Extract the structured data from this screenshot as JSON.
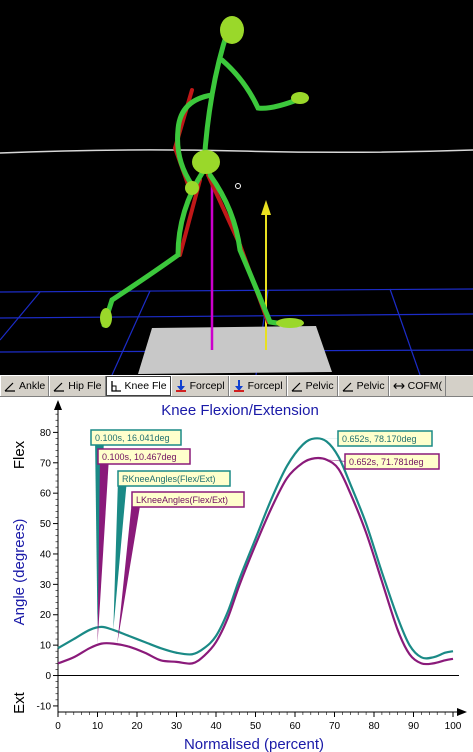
{
  "tabs": [
    {
      "label": "Ankle",
      "icon": "angle-icon",
      "active": false
    },
    {
      "label": "Hip Fle",
      "icon": "angle-icon",
      "active": false
    },
    {
      "label": "Knee Fle",
      "icon": "knee-angle-icon",
      "active": true
    },
    {
      "label": "Forcepl",
      "icon": "force-arrow-icon",
      "active": false
    },
    {
      "label": "Forcepl",
      "icon": "force-arrow-icon",
      "active": false
    },
    {
      "label": "Pelvic",
      "icon": "angle-icon",
      "active": false
    },
    {
      "label": "Pelvic",
      "icon": "angle-icon",
      "active": false
    },
    {
      "label": "COFM(",
      "icon": "double-arrow-icon",
      "active": false
    }
  ],
  "chart": {
    "flex_label": "Flex",
    "ext_label": "Ext"
  },
  "colors": {
    "right_series": "#1a8a86",
    "left_series": "#8a1a7a",
    "axis_text": "#1a1aa8",
    "box_fill": "#ffffcc",
    "force_line": "#cc00cc"
  },
  "chart_data": {
    "type": "line",
    "title": "Knee Flexion/Extension",
    "xlabel": "Normalised (percent)",
    "ylabel": "Angle (degrees)",
    "xlim": [
      0,
      100
    ],
    "ylim": [
      -12,
      90
    ],
    "xticks": [
      0,
      10,
      20,
      30,
      40,
      50,
      60,
      70,
      80,
      90,
      100
    ],
    "yticks": [
      -10,
      0,
      10,
      20,
      30,
      40,
      50,
      60,
      70,
      80
    ],
    "series": [
      {
        "name": "RKneeAngles(Flex/Ext)",
        "color": "#1a8a86",
        "x": [
          0,
          4,
          8,
          11,
          14,
          18,
          22,
          26,
          30,
          34,
          37,
          40,
          43,
          46,
          50,
          54,
          58,
          62,
          65,
          68,
          71,
          74,
          78,
          82,
          86,
          89,
          92,
          95,
          98,
          100
        ],
        "y": [
          9,
          12,
          15,
          16,
          15,
          13,
          11,
          9,
          7.5,
          7,
          9,
          13,
          21,
          32,
          45,
          58,
          69,
          76,
          78,
          77,
          72,
          63,
          50,
          34,
          19,
          10,
          6,
          6,
          7.5,
          8
        ]
      },
      {
        "name": "LKneeAngles(Flex/Ext)",
        "color": "#8a1a7a",
        "x": [
          0,
          4,
          8,
          11,
          14,
          18,
          22,
          26,
          30,
          34,
          37,
          40,
          43,
          46,
          50,
          54,
          58,
          62,
          65,
          68,
          71,
          74,
          78,
          82,
          86,
          89,
          92,
          95,
          98,
          100
        ],
        "y": [
          4,
          6,
          9,
          10.5,
          10.5,
          9.5,
          7.5,
          5,
          4.5,
          4,
          6.5,
          11,
          19,
          30,
          43,
          55,
          65,
          70,
          71.5,
          71,
          68,
          60,
          47,
          31,
          15,
          7,
          4,
          4,
          5,
          5.5
        ]
      }
    ],
    "annotations": [
      {
        "text": "0.100s, 16.041deg",
        "series": "RKneeAngles(Flex/Ext)"
      },
      {
        "text": "0.100s, 10.467deg",
        "series": "LKneeAngles(Flex/Ext)"
      },
      {
        "text": "RKneeAngles(Flex/Ext)",
        "series": "RKneeAngles(Flex/Ext)"
      },
      {
        "text": "LKneeAngles(Flex/Ext)",
        "series": "LKneeAngles(Flex/Ext)"
      },
      {
        "text": "0.652s, 78.170deg",
        "series": "RKneeAngles(Flex/Ext)"
      },
      {
        "text": "0.652s, 71.781deg",
        "series": "LKneeAngles(Flex/Ext)"
      }
    ]
  }
}
